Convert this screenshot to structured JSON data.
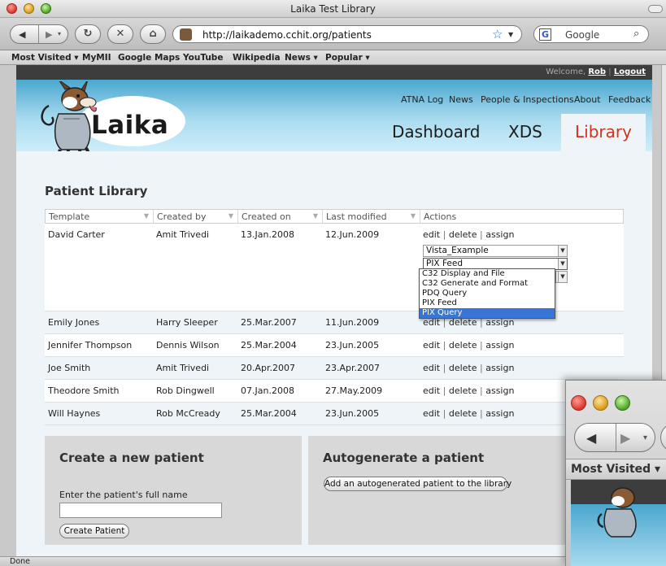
{
  "window": {
    "title": "Laika Test Library"
  },
  "toolbar": {
    "url": "http://laikademo.cchit.org/patients",
    "search_placeholder": "Google"
  },
  "bookmarks": [
    "Most Visited ▾",
    "MyMII",
    "Google Maps",
    "YouTube",
    "Wikipedia",
    "News ▾",
    "Popular ▾"
  ],
  "header": {
    "welcome": "Welcome,",
    "user": "Rob",
    "separator": "|",
    "logout": "Logout",
    "logo": "Laika",
    "top_nav": [
      "ATNA Log",
      "News",
      "People & Inspections",
      "About",
      "Feedback"
    ],
    "tabs": [
      "Dashboard",
      "XDS",
      "Library"
    ]
  },
  "main": {
    "title": "Patient Library",
    "columns": [
      "Template",
      "Created by",
      "Created on",
      "Last modified",
      "Actions"
    ],
    "actions": [
      "edit",
      "delete",
      "assign"
    ],
    "action_sep": "|",
    "rows": [
      {
        "template": "David Carter",
        "created_by": "Amit Trivedi",
        "created_on": "13.Jan.2008",
        "last_modified": "12.Jun.2009"
      },
      {
        "template": "Emily Jones",
        "created_by": "Harry Sleeper",
        "created_on": "25.Mar.2007",
        "last_modified": "11.Jun.2009"
      },
      {
        "template": "Jennifer Thompson",
        "created_by": "Dennis Wilson",
        "created_on": "25.Mar.2004",
        "last_modified": "23.Jun.2005"
      },
      {
        "template": "Joe Smith",
        "created_by": "Amit Trivedi",
        "created_on": "20.Apr.2007",
        "last_modified": "23.Apr.2007"
      },
      {
        "template": "Theodore Smith",
        "created_by": "Rob Dingwell",
        "created_on": "07.Jan.2008",
        "last_modified": "27.May.2009"
      },
      {
        "template": "Will Haynes",
        "created_by": "Rob McCready",
        "created_on": "25.Mar.2004",
        "last_modified": "23.Jun.2005"
      }
    ],
    "assign": {
      "vendor_select": "Vista_Example",
      "test_select": "PIX Feed",
      "options": [
        "C32 Display and File",
        "C32 Generate and Format",
        "PDQ Query",
        "PIX Feed",
        "PIX Query"
      ],
      "highlighted_option": "PIX Query"
    }
  },
  "create_panel": {
    "title": "Create a new patient",
    "label": "Enter the patient's full name",
    "input_value": "",
    "button": "Create Patient"
  },
  "autogen_panel": {
    "title": "Autogenerate a patient",
    "button": "Add an autogenerated patient to the library"
  },
  "status_bar": {
    "text": "Done"
  },
  "second_window": {
    "bookmark": "Most Visited ▾"
  },
  "colors": {
    "active_tab_text": "#d0341f",
    "banner_top": "#4aa7cf",
    "highlight": "#3875d7"
  }
}
